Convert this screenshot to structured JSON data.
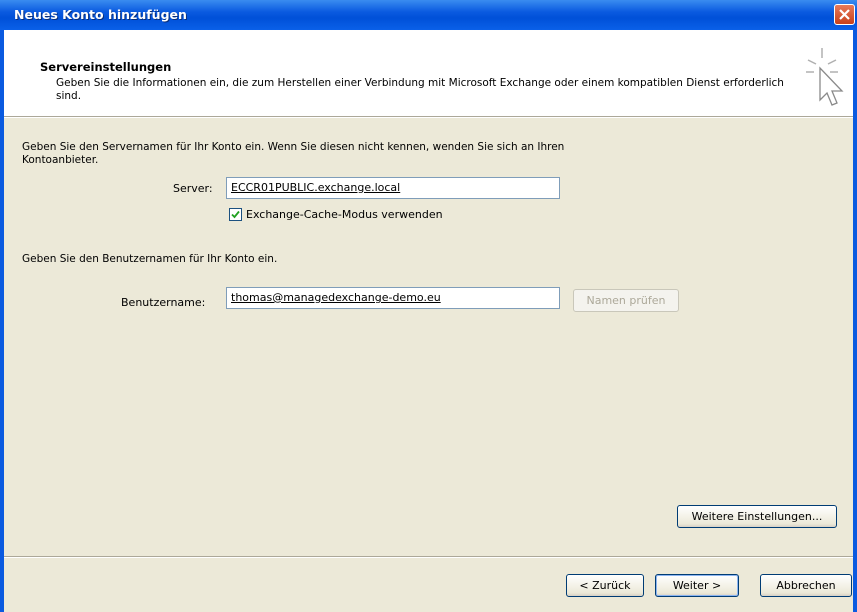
{
  "window": {
    "title": "Neues Konto hinzufügen"
  },
  "header": {
    "title": "Servereinstellungen",
    "description": "Geben Sie die Informationen ein, die zum Herstellen einer Verbindung mit Microsoft Exchange oder einem kompatiblen Dienst erforderlich sind.",
    "icon": "wizard-cursor-icon"
  },
  "server_section": {
    "intro": "Geben Sie den Servernamen für Ihr Konto ein. Wenn Sie diesen nicht kennen, wenden Sie sich an Ihren Kontoanbieter.",
    "server_label": "Server:",
    "server_value": "ECCR01PUBLIC.exchange.local",
    "cache_label": "Exchange-Cache-Modus verwenden",
    "cache_checked": true
  },
  "user_section": {
    "intro": "Geben Sie den Benutzernamen für Ihr Konto ein.",
    "username_label": "Benutzername:",
    "username_value": "thomas@managedexchange-demo.eu",
    "check_names_label": "Namen prüfen"
  },
  "buttons": {
    "more_settings": "Weitere Einstellungen...",
    "back": "< Zurück",
    "next": "Weiter >",
    "cancel": "Abbrechen"
  },
  "colors": {
    "titlebar": "#0a5ae0",
    "dialog_bg": "#ece9d8",
    "close_button": "#c8401a"
  }
}
